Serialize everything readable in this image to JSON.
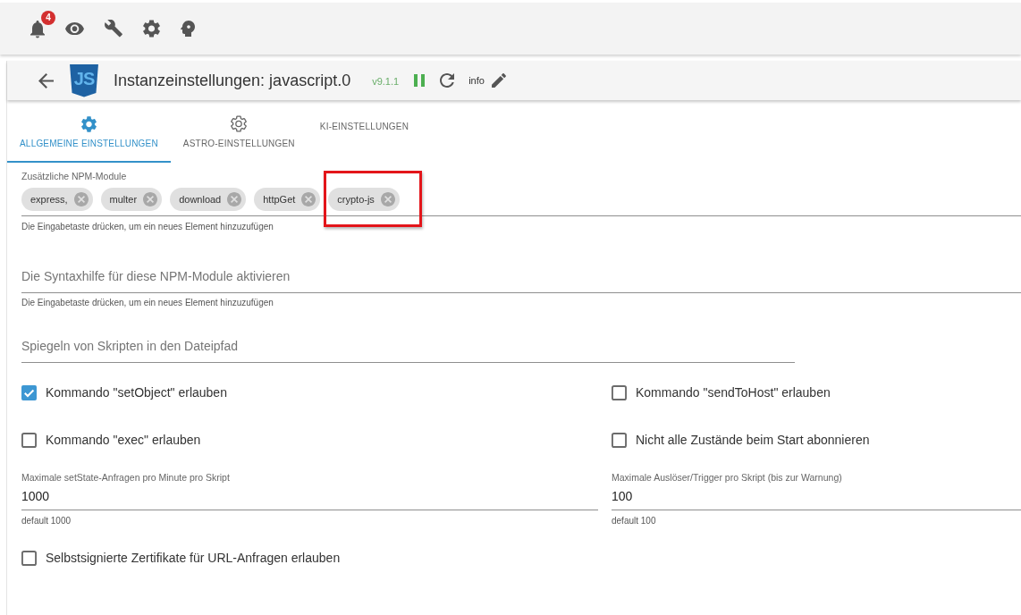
{
  "toolbar": {
    "notification_count": "4"
  },
  "instance_header": {
    "logo_text": "JS",
    "title": "Instanzeinstellungen: javascript.0",
    "version": "v9.1.1",
    "info_label": "info"
  },
  "tabs": [
    {
      "label": "ALLGEMEINE EINSTELLUNGEN",
      "kind": "gear-filled",
      "selected": true
    },
    {
      "label": "ASTRO-EINSTELLUNGEN",
      "kind": "gear-outline",
      "selected": false
    },
    {
      "label": "KI-EINSTELLUNGEN",
      "kind": "text",
      "selected": false
    }
  ],
  "npm_modules": {
    "label": "Zusätzliche NPM-Module",
    "chips": [
      {
        "label": "express,",
        "highlighted": false
      },
      {
        "label": "multer",
        "highlighted": false
      },
      {
        "label": "download",
        "highlighted": false
      },
      {
        "label": "httpGet",
        "highlighted": false
      },
      {
        "label": "crypto-js",
        "highlighted": true
      }
    ],
    "helper": "Die Eingabetaste drücken, um ein neues Element hinzuzufügen"
  },
  "syntax_help": {
    "placeholder": "Die Syntaxhilfe für diese NPM-Module aktivieren",
    "helper": "Die Eingabetaste drücken, um ein neues Element hinzuzufügen"
  },
  "mirror_path": {
    "placeholder": "Spiegeln von Skripten in den Dateipfad"
  },
  "option_rows": [
    {
      "options": [
        {
          "label": "Kommando \"setObject\" erlauben",
          "checked": true
        },
        {
          "label": "Kommando \"sendToHost\" erlauben",
          "checked": false
        }
      ]
    },
    {
      "options": [
        {
          "label": "Kommando \"exec\" erlauben",
          "checked": false
        },
        {
          "label": "Nicht alle Zustände beim Start abonnieren",
          "checked": false
        }
      ]
    }
  ],
  "limits": [
    {
      "label": "Maximale setState-Anfragen pro Minute pro Skript",
      "value": "1000",
      "helper": "default 1000"
    },
    {
      "label": "Maximale Auslöser/Trigger pro Skript (bis zur Warnung)",
      "value": "100",
      "helper": "default 100"
    }
  ],
  "self_signed_certificates": {
    "label": "Selbstsignierte Zertifikate für URL-Anfragen erlauben",
    "checked": false
  }
}
